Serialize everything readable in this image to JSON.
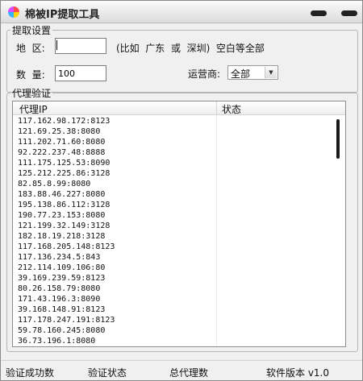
{
  "window": {
    "title": "棉被IP提取工具"
  },
  "extract_group": {
    "legend": "提取设置",
    "region_label": "地  区:",
    "region_value": "",
    "region_hint": "(比如  广东  或  深圳)  空白等全部",
    "quantity_label": "数  量:",
    "quantity_value": "100",
    "isp_label": "运营商:",
    "isp_selected": "全部"
  },
  "verify_group": {
    "legend": "代理验证",
    "columns": {
      "ip": "代理IP",
      "status": "状态"
    },
    "rows": [
      "117.162.98.172:8123",
      "121.69.25.38:8080",
      "111.202.71.60:8080",
      "92.222.237.48:8888",
      "111.175.125.53:8090",
      "125.212.225.86:3128",
      "82.85.8.99:8080",
      "183.88.46.227:8080",
      "195.138.86.112:3128",
      "190.77.23.153:8080",
      "121.199.32.149:3128",
      "182.18.19.218:3128",
      "117.168.205.148:8123",
      "117.136.234.5:843",
      "212.114.109.106:80",
      "39.169.239.59:8123",
      "80.26.158.79:8080",
      "171.43.196.3:8090",
      "39.168.148.91:8123",
      "117.178.247.191:8123",
      "59.78.160.245:8080",
      "36.73.196.1:8080"
    ]
  },
  "statusbar": {
    "success_count": "验证成功数",
    "verify_status": "验证状态",
    "total_proxies": "总代理数",
    "version": "软件版本 v1.0"
  },
  "icons": {
    "app": "app-icon",
    "minimize": "minimize-icon",
    "close": "close-icon",
    "dropdown": "chevron-down-icon"
  }
}
